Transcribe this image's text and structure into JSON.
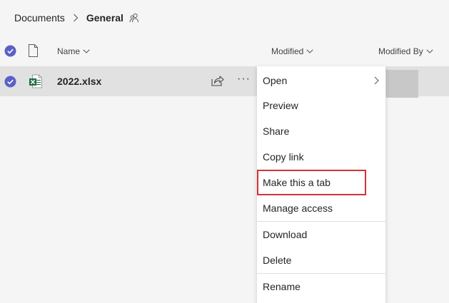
{
  "breadcrumb": {
    "root": "Documents",
    "current": "General"
  },
  "header": {
    "name": "Name",
    "modified": "Modified",
    "modified_by": "Modified By"
  },
  "file": {
    "name": "2022.xlsx",
    "icon": "excel-file-icon",
    "more": "···"
  },
  "menu": {
    "open": "Open",
    "preview": "Preview",
    "share": "Share",
    "copy_link": "Copy link",
    "make_tab": "Make this a tab",
    "manage_access": "Manage access",
    "download": "Download",
    "delete": "Delete",
    "rename": "Rename"
  },
  "colors": {
    "accent": "#5b5fc7",
    "excel_green": "#1d6f42",
    "highlight_red": "#d13438",
    "row_selected": "#e1e1e1",
    "page_bg": "#f5f5f5"
  }
}
